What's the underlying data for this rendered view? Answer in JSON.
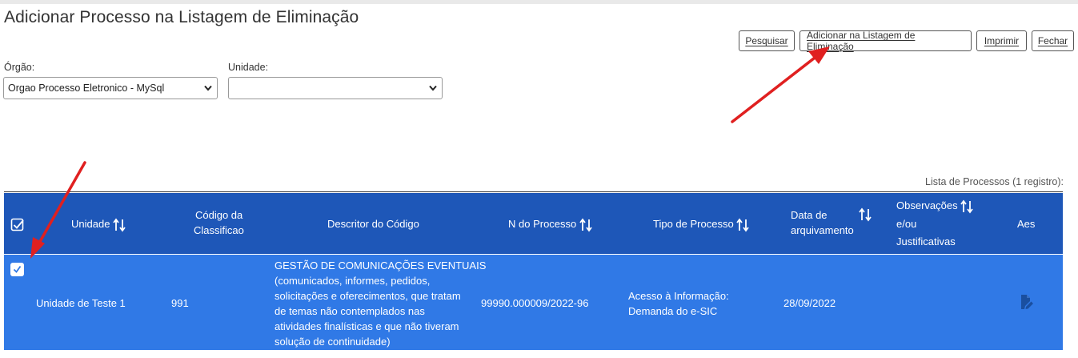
{
  "page": {
    "title": "Adicionar Processo na Listagem de Eliminação"
  },
  "toolbar": {
    "pesquisar": "Pesquisar",
    "adicionar": "Adicionar na Listagem de Eliminação",
    "imprimir": "Imprimir",
    "fechar": "Fechar"
  },
  "filters": {
    "orgao_label": "Órgão:",
    "orgao_value": "Orgao Processo Eletronico - MySql",
    "unidade_label": "Unidade:",
    "unidade_value": ""
  },
  "table": {
    "caption": "Lista de Processos (1 registro):",
    "headers": {
      "unidade": "Unidade",
      "codigo_line1": "Código da",
      "codigo_line2": "Classificao",
      "descritor": "Descritor do Código",
      "numero": "N do Processo",
      "tipo": "Tipo de Processo",
      "data_line1": "Data de",
      "data_line2": "arquivamento",
      "obs_line1": "Observações",
      "obs_line2": "e/ou",
      "obs_line3": "Justificativas",
      "acoes": "Aes"
    },
    "rows": [
      {
        "checked": true,
        "unidade": "Unidade de Teste 1",
        "codigo": "991",
        "descritor": [
          "GESTÃO DE COMUNICAÇÕES EVENTUAIS",
          "(comunicados, informes, pedidos,",
          "solicitações e oferecimentos, que tratam",
          "de temas não contemplados nas",
          "atividades finalísticas e que não tiveram",
          "solução de continuidade)"
        ],
        "numero": "99990.000009/2022-96",
        "tipo": [
          "Acesso à Informação:",
          "Demanda do e-SIC"
        ],
        "data": "28/09/2022",
        "observacoes": ""
      }
    ]
  },
  "colors": {
    "header_bg": "#1e57b8",
    "row_bg": "#3079e6",
    "arrow": "#e02020"
  },
  "icons": {
    "sort": "sort-arrows-icon",
    "select_all": "checkbox-icon",
    "action": "edit-document-icon"
  }
}
